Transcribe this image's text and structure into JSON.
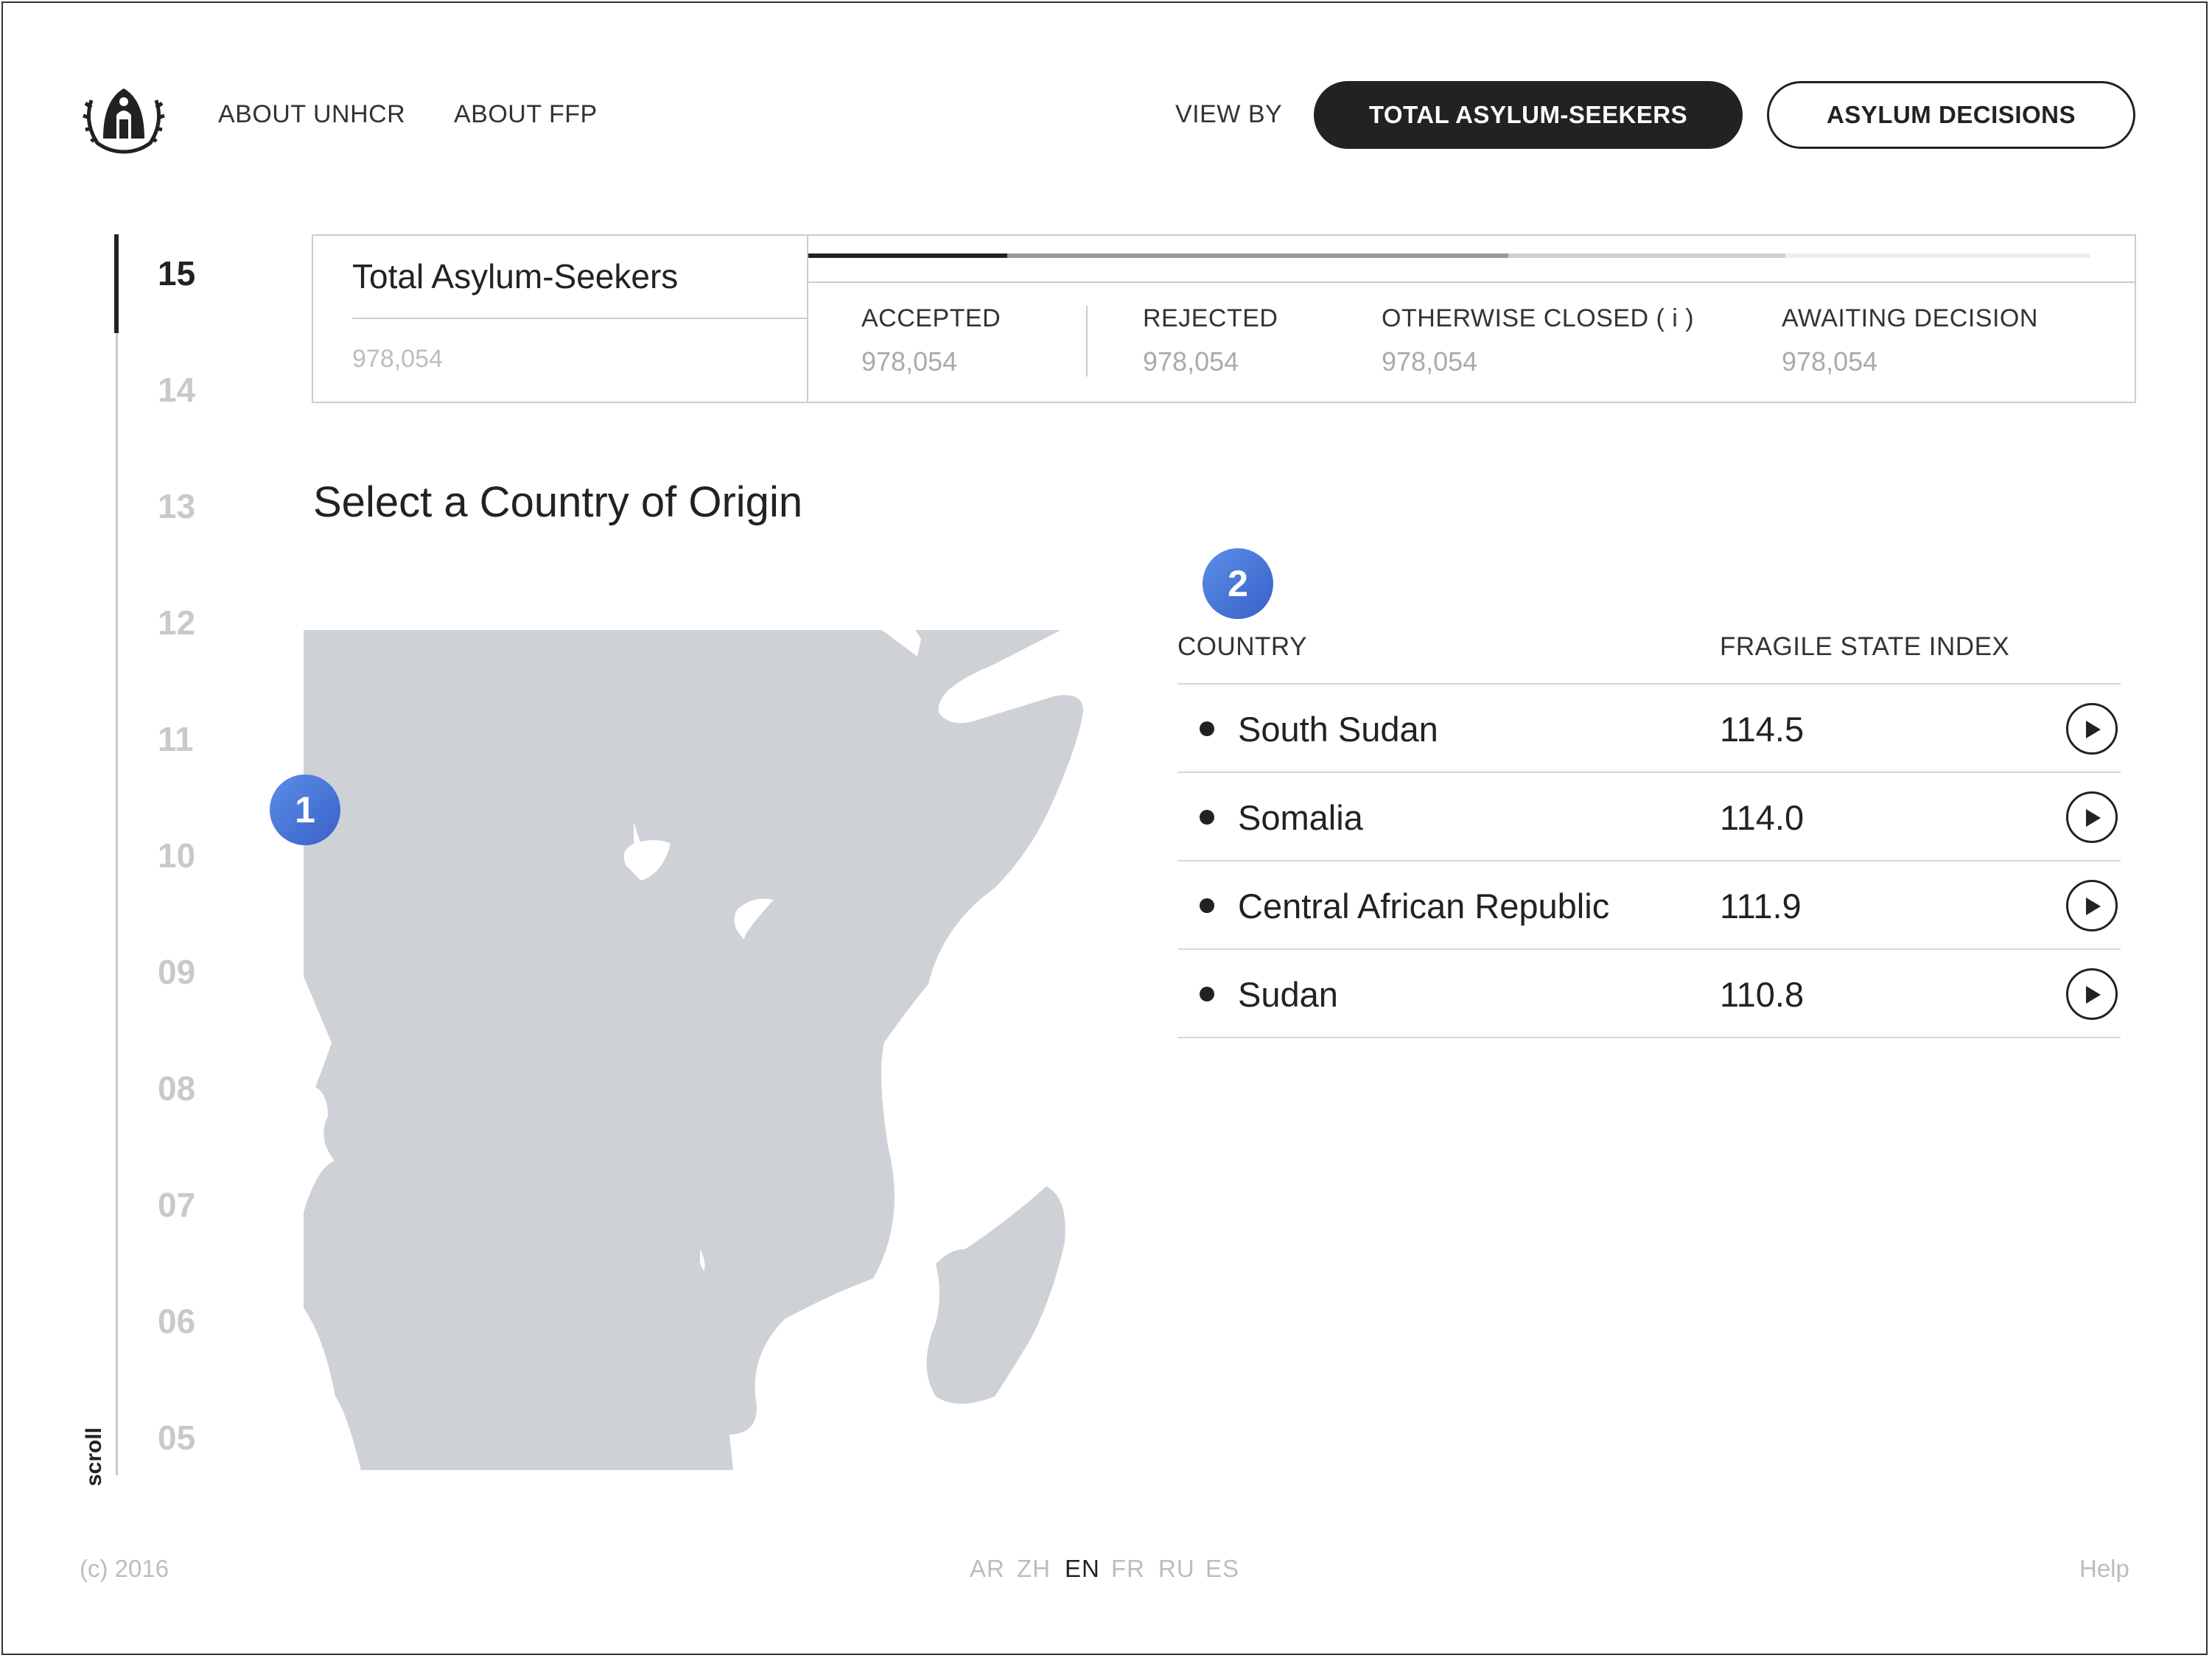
{
  "header": {
    "nav": [
      "ABOUT UNHCR",
      "ABOUT FFP"
    ],
    "view_by_label": "VIEW BY",
    "buttons": {
      "total": "TOTAL ASYLUM-SEEKERS",
      "decisions": "ASYLUM DECISIONS"
    }
  },
  "years": {
    "items": [
      "15",
      "14",
      "13",
      "12",
      "11",
      "10",
      "09",
      "08",
      "07",
      "06",
      "05"
    ],
    "active": "15",
    "scroll_label": "scroll"
  },
  "summary": {
    "title": "Total Asylum-Seekers",
    "total": "978,054",
    "stats": [
      {
        "label": "ACCEPTED",
        "value": "978,054"
      },
      {
        "label": "REJECTED",
        "value": "978,054"
      },
      {
        "label": "OTHERWISE CLOSED ( i )",
        "value": "978,054"
      },
      {
        "label": "AWAITING DECISION",
        "value": "978,054"
      }
    ],
    "bar_colors": [
      "#222222",
      "#999999",
      "#cfcfcf",
      "#eeeeee"
    ]
  },
  "section_title": "Select a Country of Origin",
  "markers": [
    "1",
    "2"
  ],
  "table": {
    "headers": {
      "country": "COUNTRY",
      "index": "FRAGILE STATE INDEX"
    },
    "rows": [
      {
        "country": "South Sudan",
        "index": "114.5"
      },
      {
        "country": "Somalia",
        "index": "114.0"
      },
      {
        "country": "Central African Republic",
        "index": "111.9"
      },
      {
        "country": "Sudan",
        "index": "110.8"
      }
    ]
  },
  "footer": {
    "copyright": "(c) 2016",
    "languages": [
      "AR",
      "ZH",
      "EN",
      "FR",
      "RU",
      "ES"
    ],
    "active_language": "EN",
    "help": "Help"
  },
  "colors": {
    "map_fill": "#ced1d6",
    "marker": "#4a78da",
    "dark": "#222222"
  },
  "icons": {
    "logo": "unhcr-logo-icon",
    "play": "play-icon"
  }
}
